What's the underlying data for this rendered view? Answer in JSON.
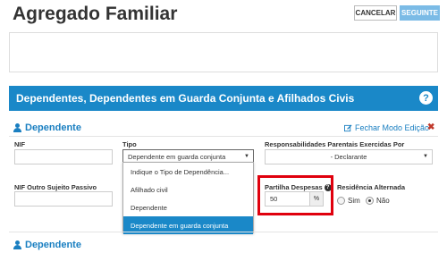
{
  "header": {
    "title": "Agregado Familiar",
    "cancel_label": "CANCELAR",
    "next_label": "SEGUINTE"
  },
  "panel": {
    "title": "Dependentes, Dependentes em Guarda Conjunta e Afilhados Civis",
    "help_icon": "?"
  },
  "section1": {
    "heading": "Dependente",
    "close_edit_label": "Fechar Modo Edição",
    "nif_label": "NIF",
    "nif_value": "",
    "tipo_label": "Tipo",
    "tipo_value": "Dependente em guarda conjunta",
    "tipo_options": [
      "Indique o Tipo de Dependência...",
      "Afilhado civil",
      "Dependente",
      "Dependente em guarda conjunta"
    ],
    "resp_label": "Responsabilidades Parentais Exercidas Por",
    "resp_value": "- Declarante",
    "nif_outro_label": "NIF Outro Sujeito Passivo",
    "nif_outro_value": "",
    "partilha_label": "Partilha Despesas",
    "partilha_value": "50",
    "partilha_suffix": "%",
    "residencia_label": "Residência Alternada",
    "residencia_options": [
      "Sim",
      "Não"
    ],
    "residencia_selected": "Não"
  },
  "section2": {
    "heading": "Dependente"
  }
}
